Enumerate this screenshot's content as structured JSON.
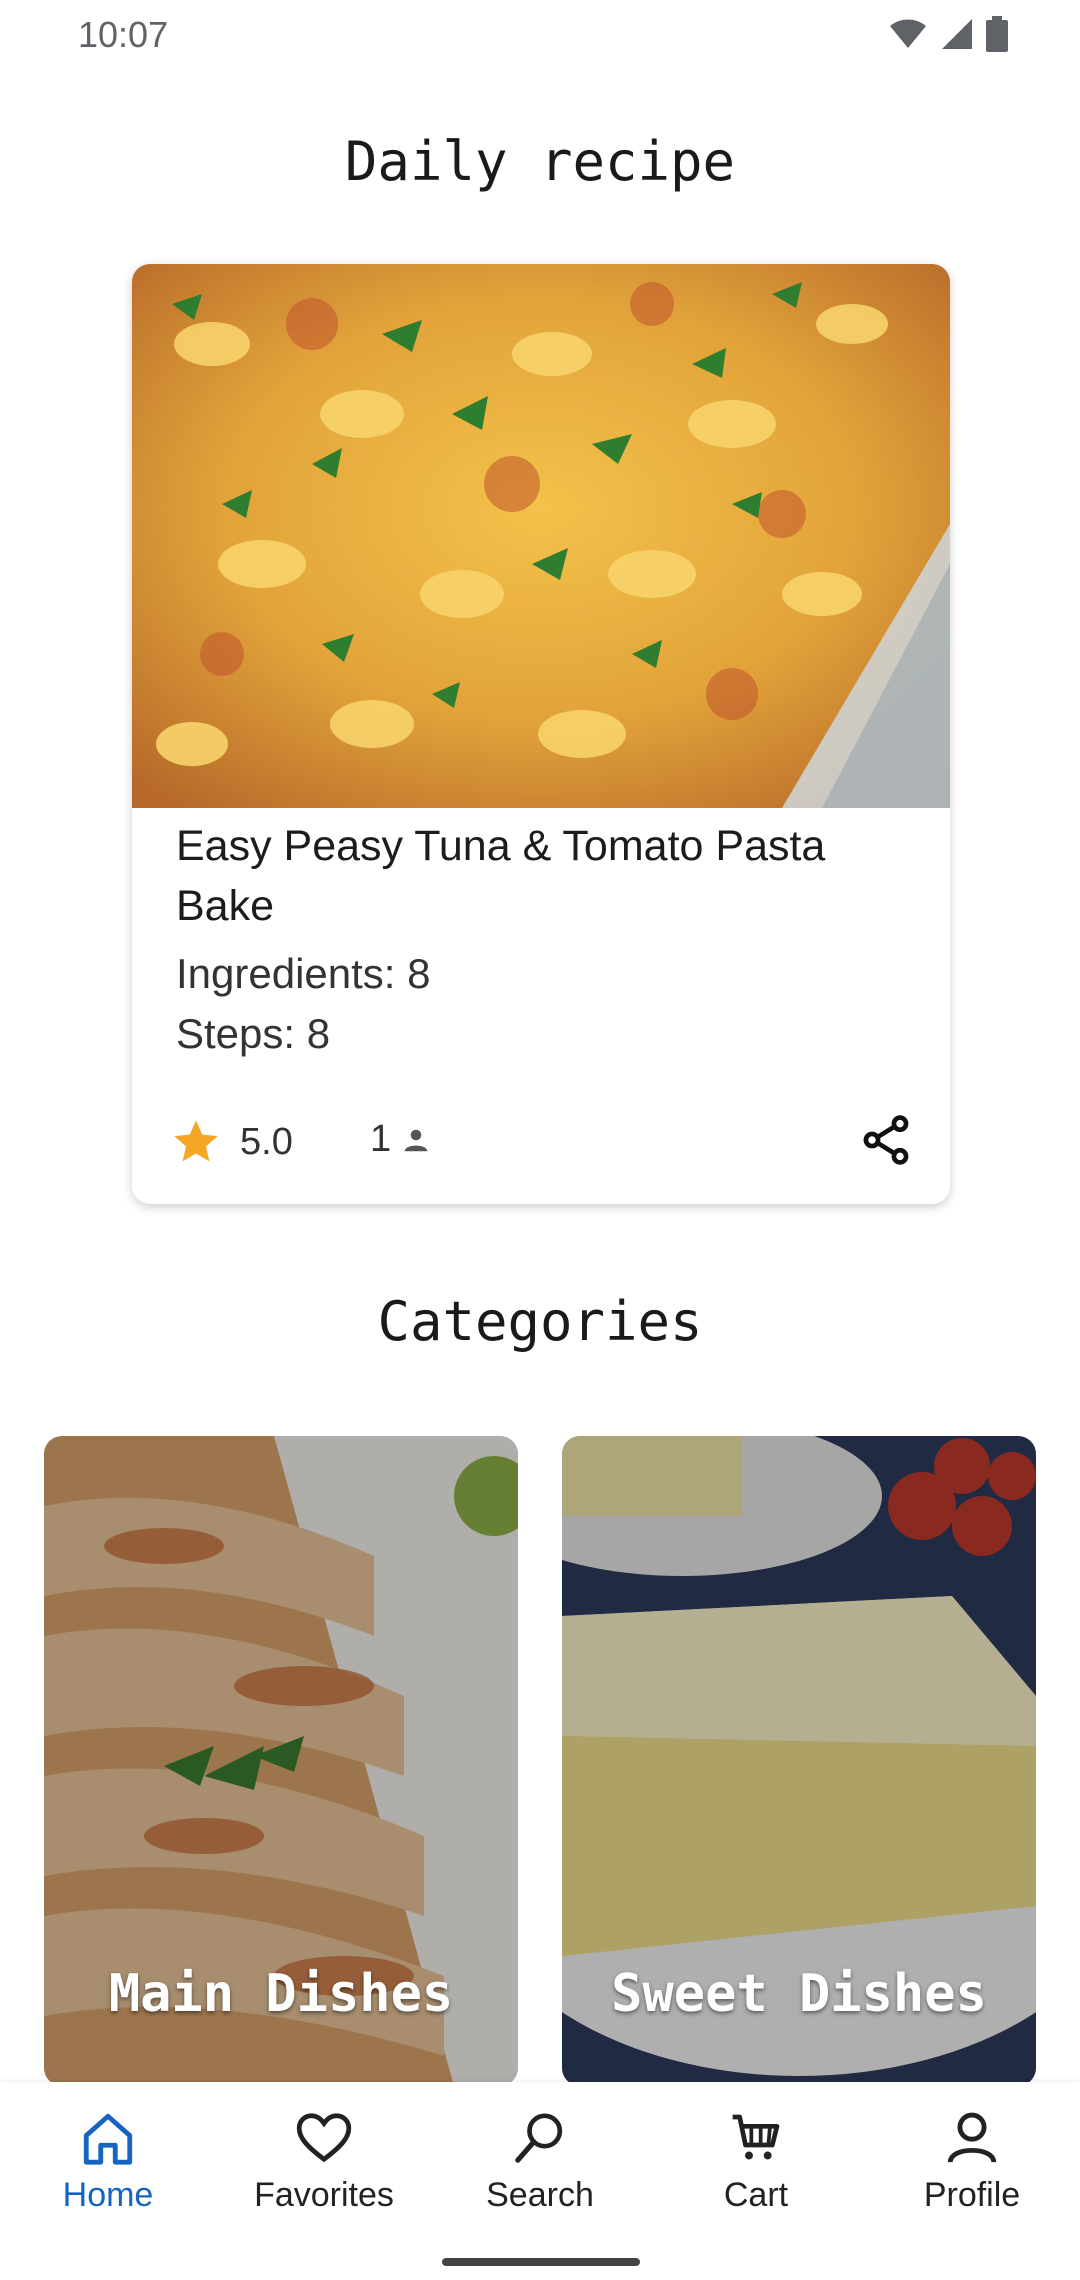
{
  "status_bar": {
    "time": "10:07"
  },
  "daily": {
    "title": "Daily recipe",
    "recipe": {
      "name": "Easy Peasy Tuna & Tomato Pasta Bake",
      "ingredients": "Ingredients: 8",
      "steps": "Steps: 8",
      "rating": "5.0",
      "reviews": "1"
    }
  },
  "categories": {
    "title": "Categories",
    "items": [
      {
        "label": "Main Dishes"
      },
      {
        "label": "Sweet Dishes"
      }
    ]
  },
  "nav": {
    "items": [
      {
        "label": "Home",
        "icon": "home-icon",
        "active": true
      },
      {
        "label": "Favorites",
        "icon": "heart-icon"
      },
      {
        "label": "Search",
        "icon": "search-icon"
      },
      {
        "label": "Cart",
        "icon": "cart-icon"
      },
      {
        "label": "Profile",
        "icon": "person-icon"
      }
    ]
  },
  "colors": {
    "accent": "#1565c0",
    "star": "#f5a623"
  }
}
